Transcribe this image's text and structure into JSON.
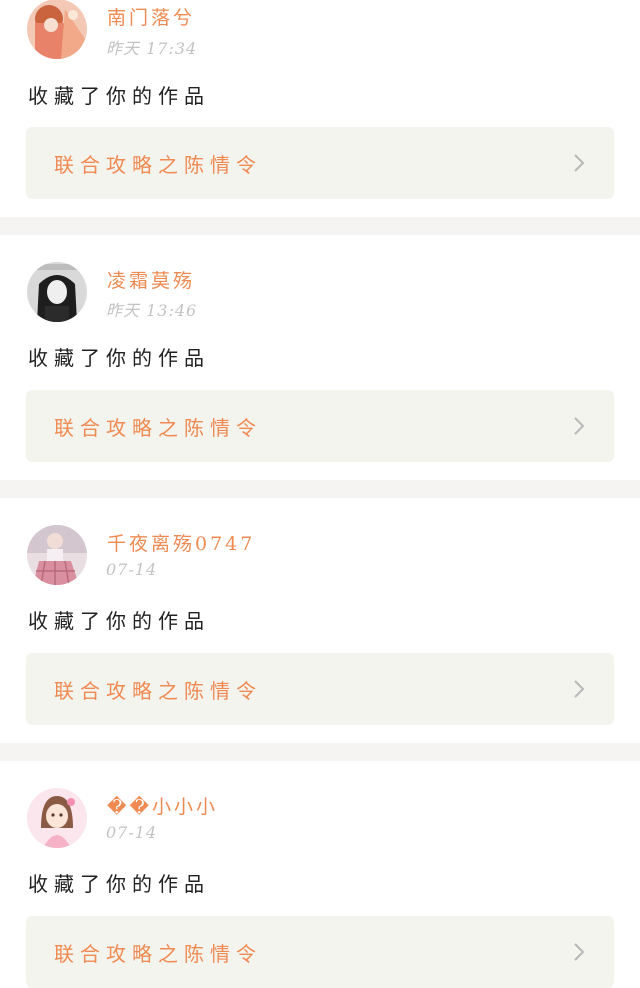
{
  "colors": {
    "accent": "#ef8a52",
    "timestamp": "#c3c3c3",
    "card_bg": "#f4f4ee",
    "separator": "#f6f3f3",
    "text": "#222222"
  },
  "notifications": [
    {
      "username": "南门落兮",
      "time": "昨天 17:34",
      "action": "收藏了你的作品",
      "work_title": "联合攻略之陈情令",
      "avatar_icon": "avatar-girl-red-hanfu-icon"
    },
    {
      "username": "凌霜莫殇",
      "time": "昨天 13:46",
      "action": "收藏了你的作品",
      "work_title": "联合攻略之陈情令",
      "avatar_icon": "avatar-girl-black-hair-icon"
    },
    {
      "username": "千夜离殇0747",
      "time": "07-14",
      "action": "收藏了你的作品",
      "work_title": "联合攻略之陈情令",
      "avatar_icon": "avatar-girl-plaid-skirt-icon"
    },
    {
      "username": "��小小小",
      "time": "07-14",
      "action": "收藏了你的作品",
      "work_title": "联合攻略之陈情令",
      "avatar_icon": "avatar-anime-girl-pink-icon"
    }
  ]
}
